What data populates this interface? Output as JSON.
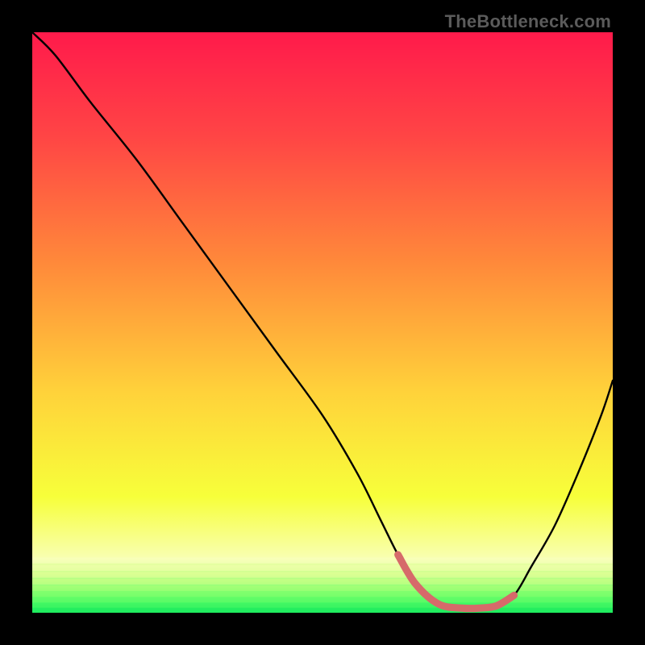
{
  "watermark": {
    "text": "TheBottleneck.com"
  },
  "colors": {
    "frame": "#000000",
    "curve": "#000000",
    "highlight": "#d66a6a",
    "gradient_stops": [
      {
        "offset": 0.0,
        "color": "#ff1a4b"
      },
      {
        "offset": 0.18,
        "color": "#ff4545"
      },
      {
        "offset": 0.4,
        "color": "#ff8a3a"
      },
      {
        "offset": 0.62,
        "color": "#ffd23a"
      },
      {
        "offset": 0.8,
        "color": "#f7ff3a"
      },
      {
        "offset": 0.905,
        "color": "#f8ffb0"
      },
      {
        "offset": 0.935,
        "color": "#c8ff8a"
      },
      {
        "offset": 0.968,
        "color": "#5fff6a"
      },
      {
        "offset": 1.0,
        "color": "#17e85e"
      }
    ],
    "band_stripes": [
      {
        "y": 0.905,
        "color": "#f9ffc3"
      },
      {
        "y": 0.918,
        "color": "#f3ffad"
      },
      {
        "y": 0.93,
        "color": "#e6ff99"
      },
      {
        "y": 0.942,
        "color": "#d4ff86"
      },
      {
        "y": 0.953,
        "color": "#b7ff77"
      },
      {
        "y": 0.963,
        "color": "#93ff6e"
      },
      {
        "y": 0.973,
        "color": "#6fff67"
      },
      {
        "y": 0.982,
        "color": "#47fa62"
      },
      {
        "y": 0.991,
        "color": "#24ef5f"
      }
    ]
  },
  "chart_data": {
    "type": "line",
    "title": "",
    "xlabel": "",
    "ylabel": "",
    "xlim": [
      0,
      100
    ],
    "ylim": [
      0,
      100
    ],
    "grid": false,
    "legend": false,
    "series": [
      {
        "name": "bottleneck-curve",
        "x": [
          0,
          4,
          10,
          18,
          26,
          34,
          42,
          50,
          56,
          60,
          63,
          66,
          70,
          74,
          77,
          80,
          83,
          86,
          90,
          94,
          98,
          100
        ],
        "y": [
          100,
          96,
          88,
          78,
          67,
          56,
          45,
          34,
          24,
          16,
          10,
          5,
          1.5,
          0.8,
          0.8,
          1.2,
          3,
          8,
          15,
          24,
          34,
          40
        ]
      }
    ],
    "highlight_segment": {
      "series": "bottleneck-curve",
      "x_start": 63,
      "x_end": 83,
      "note": "flat bottom highlighted in salmon"
    }
  }
}
